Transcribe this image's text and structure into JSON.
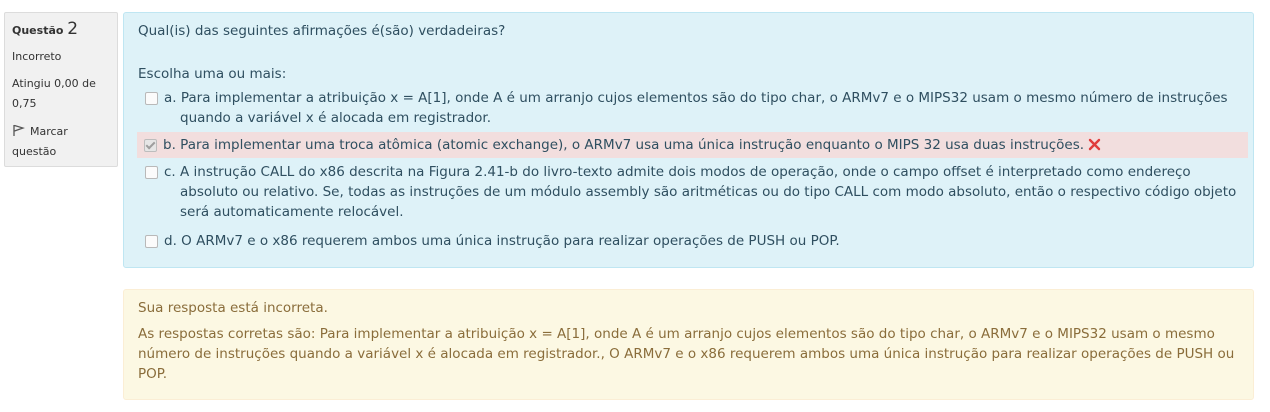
{
  "question_info": {
    "label": "Questão",
    "number": "2",
    "state": "Incorreto",
    "grade": "Atingiu 0,00 de 0,75",
    "flag_label": "Marcar questão"
  },
  "question": {
    "text": "Qual(is) das seguintes afirmações é(são) verdadeiras?",
    "prompt": "Escolha uma ou mais:",
    "options": [
      {
        "letter": "a.",
        "text": "Para implementar a atribuição x = A[1], onde A é um arranjo cujos elementos são do tipo char, o ARMv7 e o MIPS32 usam o mesmo número de instruções quando a variável x é alocada em registrador.",
        "checked": false
      },
      {
        "letter": "b.",
        "text": "Para implementar uma troca atômica (atomic exchange), o ARMv7 usa uma única instrução enquanto o MIPS 32 usa duas instruções.",
        "checked": true,
        "status": "incorrect"
      },
      {
        "letter": "c.",
        "text": "A instrução CALL do x86 descrita na Figura 2.41-b do livro-texto admite dois modos de operação, onde o campo offset é interpretado como endereço absoluto ou relativo. Se, todas as instruções de um módulo assembly são aritméticas ou do tipo CALL com modo absoluto, então o respectivo código objeto será automaticamente relocável.",
        "checked": false
      },
      {
        "letter": "d.",
        "text": "O ARMv7 e o x86 requerem ambos uma única instrução para realizar operações de PUSH ou POP.",
        "checked": false
      }
    ]
  },
  "feedback": {
    "status": "Sua resposta está incorreta.",
    "correct_answers": "As respostas corretas são: Para implementar a atribuição x = A[1], onde A é um arranjo cujos elementos são do tipo char, o ARMv7 e o MIPS32 usam o mesmo número de instruções quando a variável x é alocada em registrador., O ARMv7 e o x86 requerem ambos uma única instrução para realizar operações de PUSH ou POP."
  },
  "colors": {
    "info_bg": "#f1f1f1",
    "question_bg": "#def2f8",
    "incorrect_bg": "#f2dede",
    "feedback_bg": "#fcf8e3",
    "x_mark": "#e03a3a"
  },
  "icons": {
    "flag": "flag-icon",
    "incorrect": "x-mark-icon"
  }
}
